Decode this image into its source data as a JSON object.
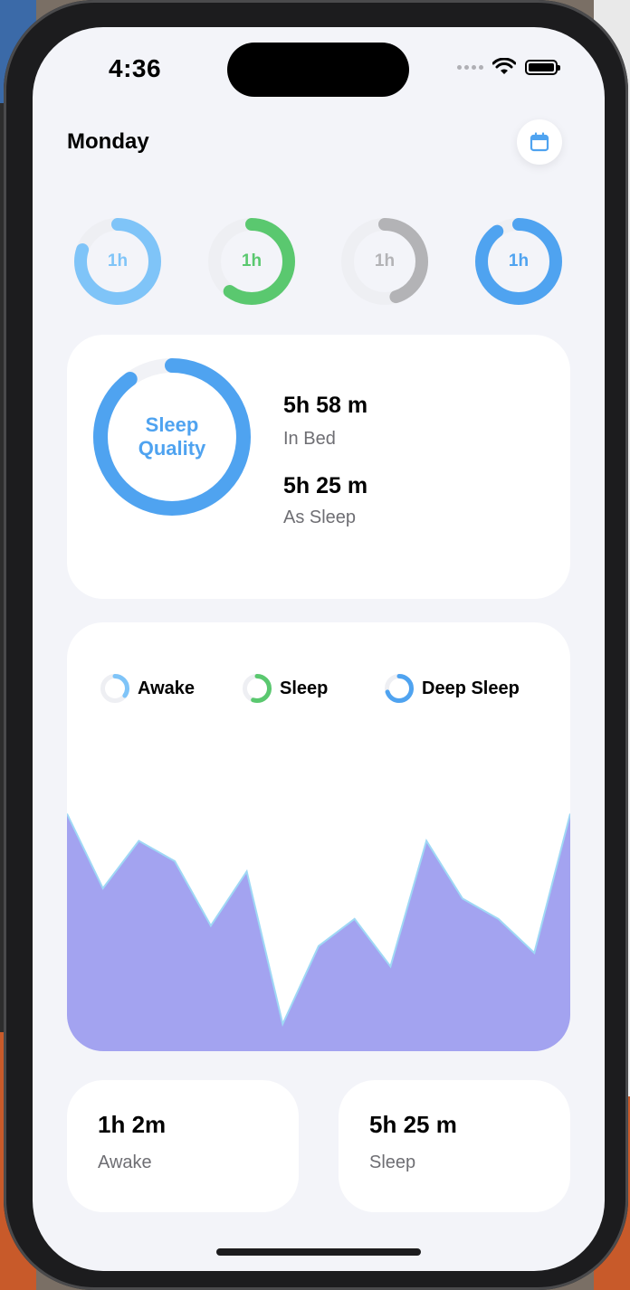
{
  "status": {
    "time": "4:36"
  },
  "header": {
    "title": "Monday"
  },
  "colors": {
    "light_blue": "#7fc4f8",
    "green": "#5ac86f",
    "gray": "#b3b3b6",
    "blue": "#4fa3f0",
    "chart_fill": "#a3a3f0"
  },
  "rings": [
    {
      "label": "1h",
      "color": "#7fc4f8",
      "progress": 0.8
    },
    {
      "label": "1h",
      "color": "#5ac86f",
      "progress": 0.6
    },
    {
      "label": "1h",
      "color": "#b3b3b6",
      "progress": 0.45
    },
    {
      "label": "1h",
      "color": "#4fa3f0",
      "progress": 0.9
    }
  ],
  "quality": {
    "title_line1": "Sleep",
    "title_line2": "Quality",
    "progress": 0.9,
    "in_bed_value": "5h 58 m",
    "in_bed_label": "In Bed",
    "asleep_value": "5h 25 m",
    "asleep_label": "As Sleep"
  },
  "legend": [
    {
      "label": "Awake",
      "color": "#7fc4f8",
      "progress": 0.35
    },
    {
      "label": "Sleep",
      "color": "#5ac86f",
      "progress": 0.55
    },
    {
      "label": "Deep Sleep",
      "color": "#4fa3f0",
      "progress": 0.7
    }
  ],
  "chart_data": {
    "type": "area",
    "x": [
      0,
      1,
      2,
      3,
      4,
      5,
      6,
      7,
      8,
      9,
      10,
      11,
      12,
      13,
      14
    ],
    "values": [
      70,
      48,
      62,
      56,
      37,
      53,
      8,
      31,
      39,
      25,
      62,
      45,
      39,
      29,
      70
    ],
    "ylim": [
      0,
      80
    ],
    "grid": false,
    "title": "",
    "xlabel": "",
    "ylabel": ""
  },
  "summary": [
    {
      "value": "1h 2m",
      "label": "Awake"
    },
    {
      "value": "5h 25 m",
      "label": "Sleep"
    }
  ]
}
